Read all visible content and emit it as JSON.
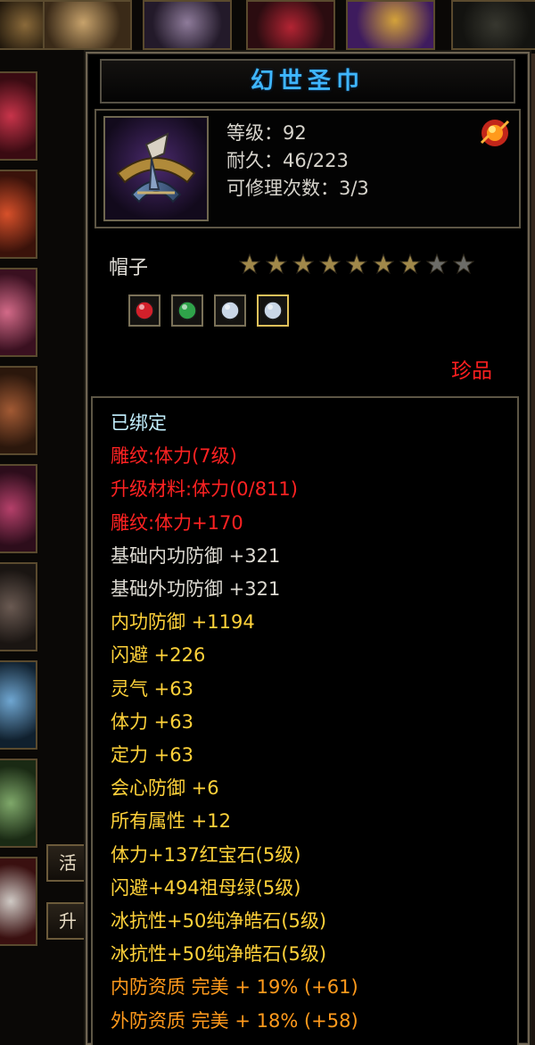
{
  "background": {
    "buttons": [
      "活",
      "升"
    ]
  },
  "tooltip": {
    "title": "幻世圣巾",
    "info": {
      "level": "等级：92",
      "durability": "耐久：46/223",
      "repairs": "可修理次数：3/3"
    },
    "item_type": "帽子",
    "stars": {
      "filled": 7,
      "total": 9
    },
    "sockets": [
      {
        "gem": "ruby-gem-icon",
        "color": "#d2202a"
      },
      {
        "gem": "emerald-gem-icon",
        "color": "#2fa34a"
      },
      {
        "gem": "crystal-gem-icon",
        "color": "#c9d6e6"
      },
      {
        "gem": "crystal-gem-icon",
        "color": "#c9d6e6"
      }
    ],
    "rarity": "珍品",
    "attributes": [
      {
        "text": "已绑定",
        "color": "cyan"
      },
      {
        "text": "雕纹:体力(7级)",
        "color": "red"
      },
      {
        "text": "升级材料:体力(0/811)",
        "color": "red"
      },
      {
        "text": "雕纹:体力+170",
        "color": "red"
      },
      {
        "text": "基础内功防御 +321",
        "color": "white"
      },
      {
        "text": "基础外功防御 +321",
        "color": "white"
      },
      {
        "text": "内功防御 +1194",
        "color": "gold"
      },
      {
        "text": "闪避 +226",
        "color": "gold"
      },
      {
        "text": "灵气 +63",
        "color": "gold"
      },
      {
        "text": "体力 +63",
        "color": "gold"
      },
      {
        "text": "定力 +63",
        "color": "gold"
      },
      {
        "text": "会心防御 +6",
        "color": "gold"
      },
      {
        "text": "所有属性 +12",
        "color": "gold"
      },
      {
        "text": "体力+137红宝石(5级)",
        "color": "gold"
      },
      {
        "text": "闪避+494祖母绿(5级)",
        "color": "gold"
      },
      {
        "text": "冰抗性+50纯净皓石(5级)",
        "color": "gold"
      },
      {
        "text": "冰抗性+50纯净皓石(5级)",
        "color": "gold"
      },
      {
        "text": "内防资质 完美 + 19% (+61)",
        "color": "orange"
      },
      {
        "text": "外防资质 完美 + 18% (+58)",
        "color": "orange"
      }
    ]
  },
  "colors": {
    "title": "#3fb6ff",
    "rarity": "#ff2020",
    "star_filled": "#a0884a",
    "star_empty": "#6c6c68"
  }
}
